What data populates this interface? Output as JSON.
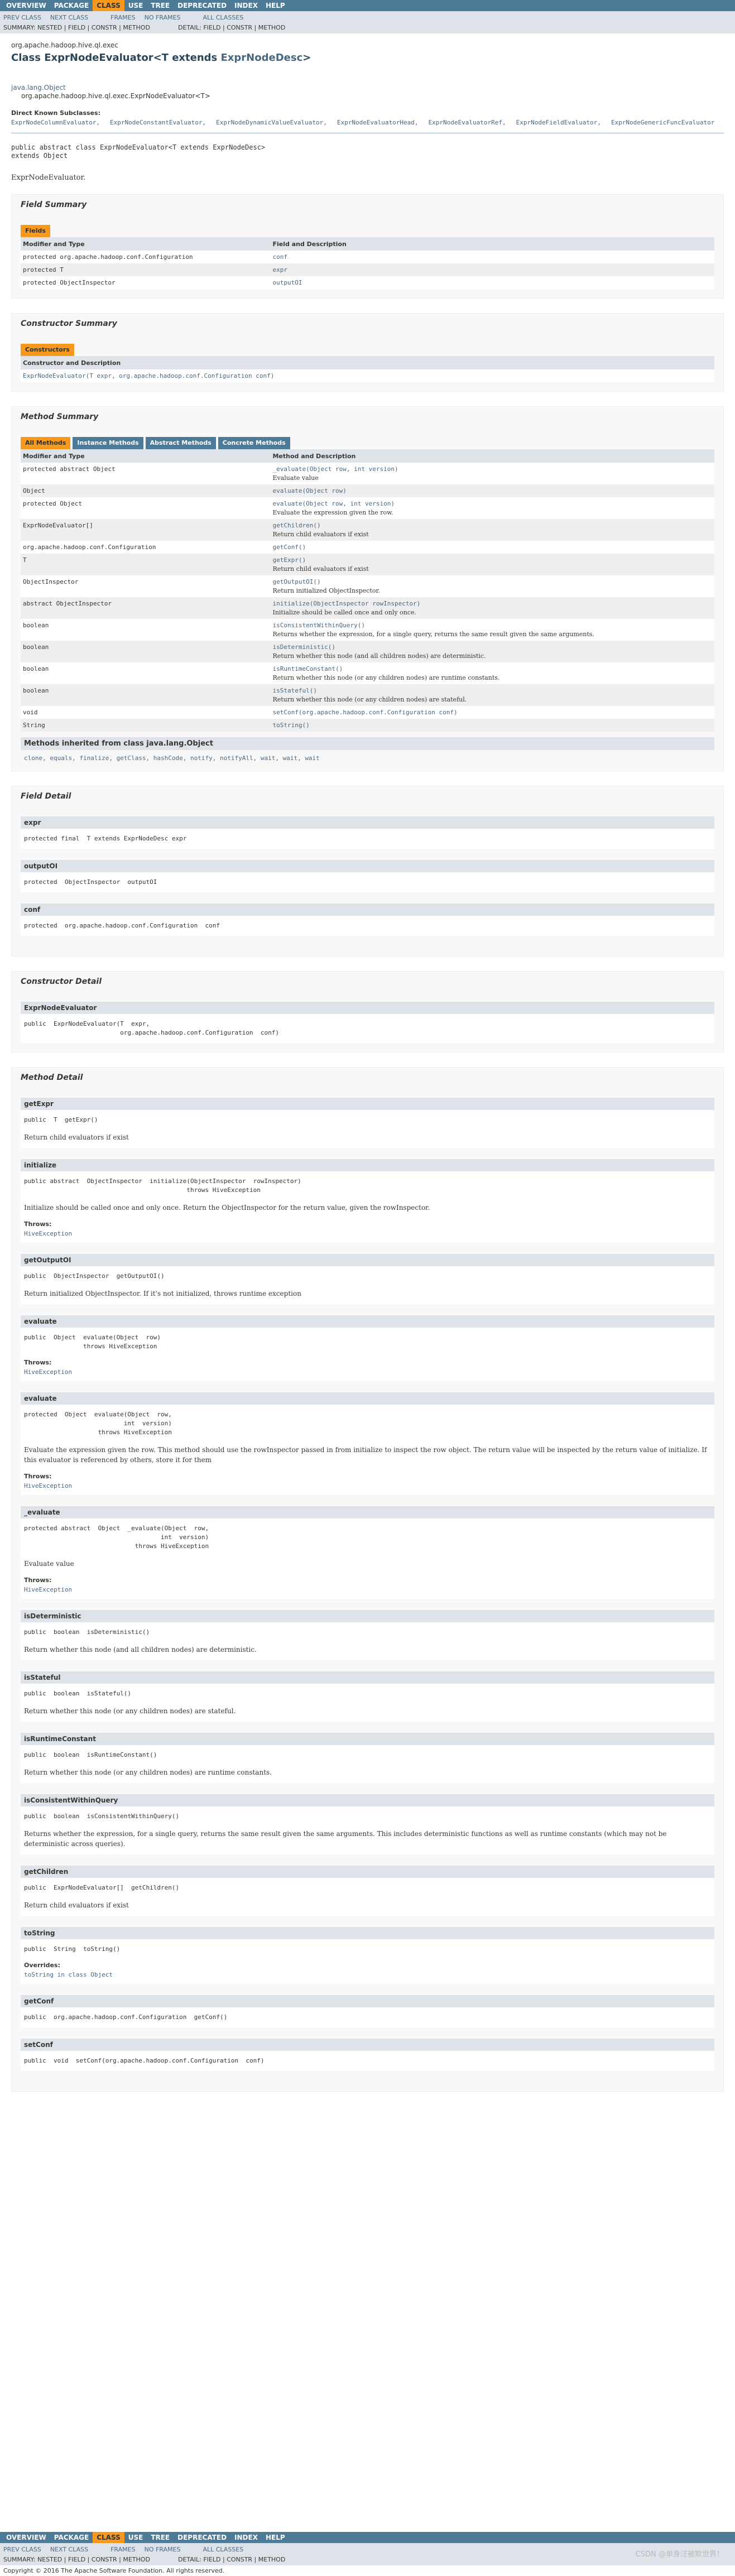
{
  "nav": {
    "items": [
      "OVERVIEW",
      "PACKAGE",
      "CLASS",
      "USE",
      "TREE",
      "DEPRECATED",
      "INDEX",
      "HELP"
    ],
    "active": "CLASS",
    "prev_class": "PREV CLASS",
    "next_class": "NEXT CLASS",
    "frames": "FRAMES",
    "no_frames": "NO FRAMES",
    "all_classes": "ALL CLASSES",
    "summary": "SUMMARY: NESTED | FIELD | CONSTR | METHOD",
    "detail": "DETAIL: FIELD | CONSTR | METHOD"
  },
  "header": {
    "package": "org.apache.hadoop.hive.ql.exec",
    "title_prefix": "Class ExprNodeEvaluator<T extends ",
    "title_link": "ExprNodeDesc",
    "title_suffix": ">",
    "inherit_root": "java.lang.Object",
    "inherit_self": "org.apache.hadoop.hive.ql.exec.ExprNodeEvaluator<T>",
    "subclasses_label": "Direct Known Subclasses:",
    "subclasses": [
      "ExprNodeColumnEvaluator,",
      "ExprNodeConstantEvaluator,",
      "ExprNodeDynamicValueEvaluator,",
      "ExprNodeEvaluatorHead,",
      "ExprNodeEvaluatorRef,",
      "ExprNodeFieldEvaluator,",
      "ExprNodeGenericFuncEvaluator"
    ],
    "decl_line1": "public abstract class ExprNodeEvaluator<T extends ExprNodeDesc>",
    "decl_line2": "extends Object",
    "description": "ExprNodeEvaluator."
  },
  "field_summary": {
    "title": "Field Summary",
    "tab": "Fields",
    "col1": "Modifier and Type",
    "col2": "Field and Description",
    "rows": [
      {
        "type": "protected org.apache.hadoop.conf.Configuration",
        "name": "conf"
      },
      {
        "type": "protected T",
        "name": "expr"
      },
      {
        "type": "protected ObjectInspector",
        "name": "outputOI"
      }
    ]
  },
  "constructor_summary": {
    "title": "Constructor Summary",
    "tab": "Constructors",
    "col": "Constructor and Description",
    "row": "ExprNodeEvaluator(T  expr, org.apache.hadoop.conf.Configuration  conf)"
  },
  "method_summary": {
    "title": "Method Summary",
    "tabs": [
      "All Methods",
      "Instance Methods",
      "Abstract Methods",
      "Concrete Methods"
    ],
    "col1": "Modifier and Type",
    "col2": "Method and Description",
    "rows": [
      {
        "type": "protected abstract Object",
        "sig": "_evaluate(Object  row, int  version)",
        "desc": "Evaluate value"
      },
      {
        "type": "Object",
        "sig": "evaluate(Object  row)",
        "desc": ""
      },
      {
        "type": "protected Object",
        "sig": "evaluate(Object  row, int  version)",
        "desc": "Evaluate the expression given the row."
      },
      {
        "type": "ExprNodeEvaluator[]",
        "sig": "getChildren()",
        "desc": "Return child evaluators if exist"
      },
      {
        "type": "org.apache.hadoop.conf.Configuration",
        "sig": "getConf()",
        "desc": ""
      },
      {
        "type": "T",
        "sig": "getExpr()",
        "desc": "Return child evaluators if exist"
      },
      {
        "type": "ObjectInspector",
        "sig": "getOutputOI()",
        "desc": "Return initialized ObjectInspector."
      },
      {
        "type": "abstract ObjectInspector",
        "sig": "initialize(ObjectInspector  rowInspector)",
        "desc": "Initialize should be called once and only once."
      },
      {
        "type": "boolean",
        "sig": "isConsistentWithinQuery()",
        "desc": "Returns whether the expression, for a single query, returns the same result given the same arguments."
      },
      {
        "type": "boolean",
        "sig": "isDeterministic()",
        "desc": "Return whether this node (and all children nodes) are deterministic."
      },
      {
        "type": "boolean",
        "sig": "isRuntimeConstant()",
        "desc": "Return whether this node (or any children nodes) are runtime constants."
      },
      {
        "type": "boolean",
        "sig": "isStateful()",
        "desc": "Return whether this node (or any children nodes) are stateful."
      },
      {
        "type": "void",
        "sig": "setConf(org.apache.hadoop.conf.Configuration  conf)",
        "desc": ""
      },
      {
        "type": "String",
        "sig": "toString()",
        "desc": ""
      }
    ],
    "inherited_title": "Methods inherited from class java.lang.Object",
    "inherited_list": "clone, equals, finalize, getClass, hashCode, notify, notifyAll, wait, wait, wait"
  },
  "field_detail": {
    "title": "Field Detail",
    "items": [
      {
        "name": "expr",
        "sig": "protected final  T extends ExprNodeDesc expr"
      },
      {
        "name": "outputOI",
        "sig": "protected  ObjectInspector  outputOI"
      },
      {
        "name": "conf",
        "sig": "protected  org.apache.hadoop.conf.Configuration  conf"
      }
    ]
  },
  "constructor_detail": {
    "title": "Constructor Detail",
    "name": "ExprNodeEvaluator",
    "sig": "public  ExprNodeEvaluator(T  expr,\n                          org.apache.hadoop.conf.Configuration  conf)"
  },
  "method_detail": {
    "title": "Method Detail",
    "throws_label": "Throws:",
    "overrides_label": "Overrides:",
    "items": [
      {
        "name": "getExpr",
        "sig": "public  T  getExpr()",
        "desc": "Return child evaluators if exist",
        "throws": "",
        "overrides": ""
      },
      {
        "name": "initialize",
        "sig": "public abstract  ObjectInspector  initialize(ObjectInspector  rowInspector)\n                                            throws HiveException",
        "desc": "Initialize should be called once and only once. Return the ObjectInspector for the return value, given the rowInspector.",
        "throws": "HiveException",
        "overrides": ""
      },
      {
        "name": "getOutputOI",
        "sig": "public  ObjectInspector  getOutputOI()",
        "desc": "Return initialized ObjectInspector. If it's not initialized, throws runtime exception",
        "throws": "",
        "overrides": ""
      },
      {
        "name": "evaluate",
        "sig": "public  Object  evaluate(Object  row)\n                throws HiveException",
        "desc": "",
        "throws": "HiveException",
        "overrides": ""
      },
      {
        "name": "evaluate",
        "sig": "protected  Object  evaluate(Object  row,\n                           int  version)\n                    throws HiveException",
        "desc": "Evaluate the expression given the row. This method should use the rowInspector passed in from initialize to inspect the row object. The return value will be inspected by the return value of initialize. If this evaluator is referenced by others, store it for them",
        "throws": "HiveException",
        "overrides": ""
      },
      {
        "name": "_evaluate",
        "sig": "protected abstract  Object  _evaluate(Object  row,\n                                     int  version)\n                              throws HiveException",
        "desc": "Evaluate value",
        "throws": "HiveException",
        "overrides": ""
      },
      {
        "name": "isDeterministic",
        "sig": "public  boolean  isDeterministic()",
        "desc": "Return whether this node (and all children nodes) are deterministic.",
        "throws": "",
        "overrides": ""
      },
      {
        "name": "isStateful",
        "sig": "public  boolean  isStateful()",
        "desc": "Return whether this node (or any children nodes) are stateful.",
        "throws": "",
        "overrides": ""
      },
      {
        "name": "isRuntimeConstant",
        "sig": "public  boolean  isRuntimeConstant()",
        "desc": "Return whether this node (or any children nodes) are runtime constants.",
        "throws": "",
        "overrides": ""
      },
      {
        "name": "isConsistentWithinQuery",
        "sig": "public  boolean  isConsistentWithinQuery()",
        "desc": "Returns whether the expression, for a single query, returns the same result given the same arguments. This includes deterministic functions as well as runtime constants (which may not be deterministic across queries).",
        "throws": "",
        "overrides": ""
      },
      {
        "name": "getChildren",
        "sig": "public  ExprNodeEvaluator[]  getChildren()",
        "desc": "Return child evaluators if exist",
        "throws": "",
        "overrides": ""
      },
      {
        "name": "toString",
        "sig": "public  String  toString()",
        "desc": "",
        "throws": "",
        "overrides": "toString  in class  Object"
      },
      {
        "name": "getConf",
        "sig": "public  org.apache.hadoop.conf.Configuration  getConf()",
        "desc": "",
        "throws": "",
        "overrides": ""
      },
      {
        "name": "setConf",
        "sig": "public  void  setConf(org.apache.hadoop.conf.Configuration  conf)",
        "desc": "",
        "throws": "",
        "overrides": ""
      }
    ]
  },
  "footer": {
    "copyright": "Copyright © 2016 The Apache Software Foundation. All rights reserved.",
    "watermark": "CSDN @单身汪被欺世界！"
  },
  "colors": {
    "nav": "#4d7a97",
    "active_tab": "#f8981d",
    "header_bg": "#dee3e9",
    "link": "#4a6782"
  }
}
